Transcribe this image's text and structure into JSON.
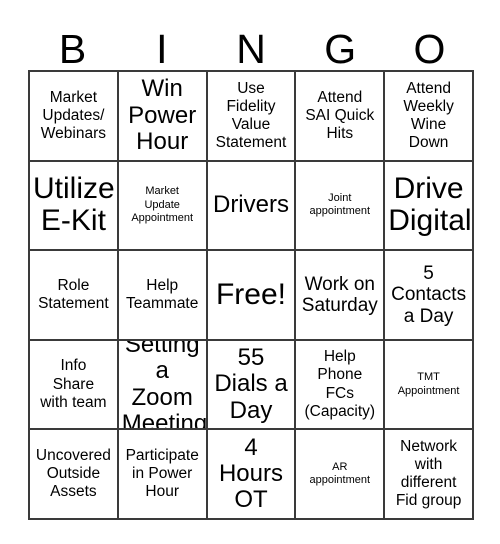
{
  "card": {
    "title": "BINGO",
    "header_letters": [
      "B",
      "I",
      "N",
      "G",
      "O"
    ],
    "columns": 5,
    "rows": 5,
    "border_color": "#3a3a3a",
    "background_color": "#ffffff",
    "text_color": "#000000",
    "free_space_label": "Free!",
    "free_space_position": "row 3, column 3"
  },
  "cells": [
    {
      "id": "b1",
      "row": 1,
      "col": 1,
      "text": "Market\nUpdates/\nWebinars",
      "size": "sm"
    },
    {
      "id": "i1",
      "row": 1,
      "col": 2,
      "text": "Win\nPower\nHour",
      "size": "lg"
    },
    {
      "id": "n1",
      "row": 1,
      "col": 3,
      "text": "Use\nFidelity\nValue\nStatement",
      "size": "sm"
    },
    {
      "id": "g1",
      "row": 1,
      "col": 4,
      "text": "Attend\nSAI Quick\nHits",
      "size": "sm"
    },
    {
      "id": "o1",
      "row": 1,
      "col": 5,
      "text": "Attend\nWeekly\nWine\nDown",
      "size": "sm"
    },
    {
      "id": "b2",
      "row": 2,
      "col": 1,
      "text": "Utilize\nE-Kit",
      "size": "xl"
    },
    {
      "id": "i2",
      "row": 2,
      "col": 2,
      "text": "Market\nUpdate\nAppointment",
      "size": "xs"
    },
    {
      "id": "n2",
      "row": 2,
      "col": 3,
      "text": "Drivers",
      "size": "lg"
    },
    {
      "id": "g2",
      "row": 2,
      "col": 4,
      "text": "Joint\nappointment",
      "size": "xs"
    },
    {
      "id": "o2",
      "row": 2,
      "col": 5,
      "text": "Drive\nDigital",
      "size": "xl"
    },
    {
      "id": "b3",
      "row": 3,
      "col": 1,
      "text": "Role\nStatement",
      "size": "sm"
    },
    {
      "id": "i3",
      "row": 3,
      "col": 2,
      "text": "Help\nTeammate",
      "size": "sm"
    },
    {
      "id": "n3",
      "row": 3,
      "col": 3,
      "text": "Free!",
      "size": "xl"
    },
    {
      "id": "g3",
      "row": 3,
      "col": 4,
      "text": "Work on\nSaturday",
      "size": "md"
    },
    {
      "id": "o3",
      "row": 3,
      "col": 5,
      "text": "5\nContacts\na Day",
      "size": "md"
    },
    {
      "id": "b4",
      "row": 4,
      "col": 1,
      "text": "Info\nShare\nwith team",
      "size": "sm"
    },
    {
      "id": "i4",
      "row": 4,
      "col": 2,
      "text": "Setting\na Zoom\nMeeting",
      "size": "lg"
    },
    {
      "id": "n4",
      "row": 4,
      "col": 3,
      "text": "55\nDials a\nDay",
      "size": "lg"
    },
    {
      "id": "g4",
      "row": 4,
      "col": 4,
      "text": "Help\nPhone\nFCs\n(Capacity)",
      "size": "sm"
    },
    {
      "id": "o4",
      "row": 4,
      "col": 5,
      "text": "TMT\nAppointment",
      "size": "xs"
    },
    {
      "id": "b5",
      "row": 5,
      "col": 1,
      "text": "Uncovered\nOutside\nAssets",
      "size": "sm"
    },
    {
      "id": "i5",
      "row": 5,
      "col": 2,
      "text": "Participate\nin Power\nHour",
      "size": "sm"
    },
    {
      "id": "n5",
      "row": 5,
      "col": 3,
      "text": "4\nHours\nOT",
      "size": "lg"
    },
    {
      "id": "g5",
      "row": 5,
      "col": 4,
      "text": "AR\nappointment",
      "size": "xs"
    },
    {
      "id": "o5",
      "row": 5,
      "col": 5,
      "text": "Network\nwith\ndifferent\nFid group",
      "size": "sm"
    }
  ]
}
